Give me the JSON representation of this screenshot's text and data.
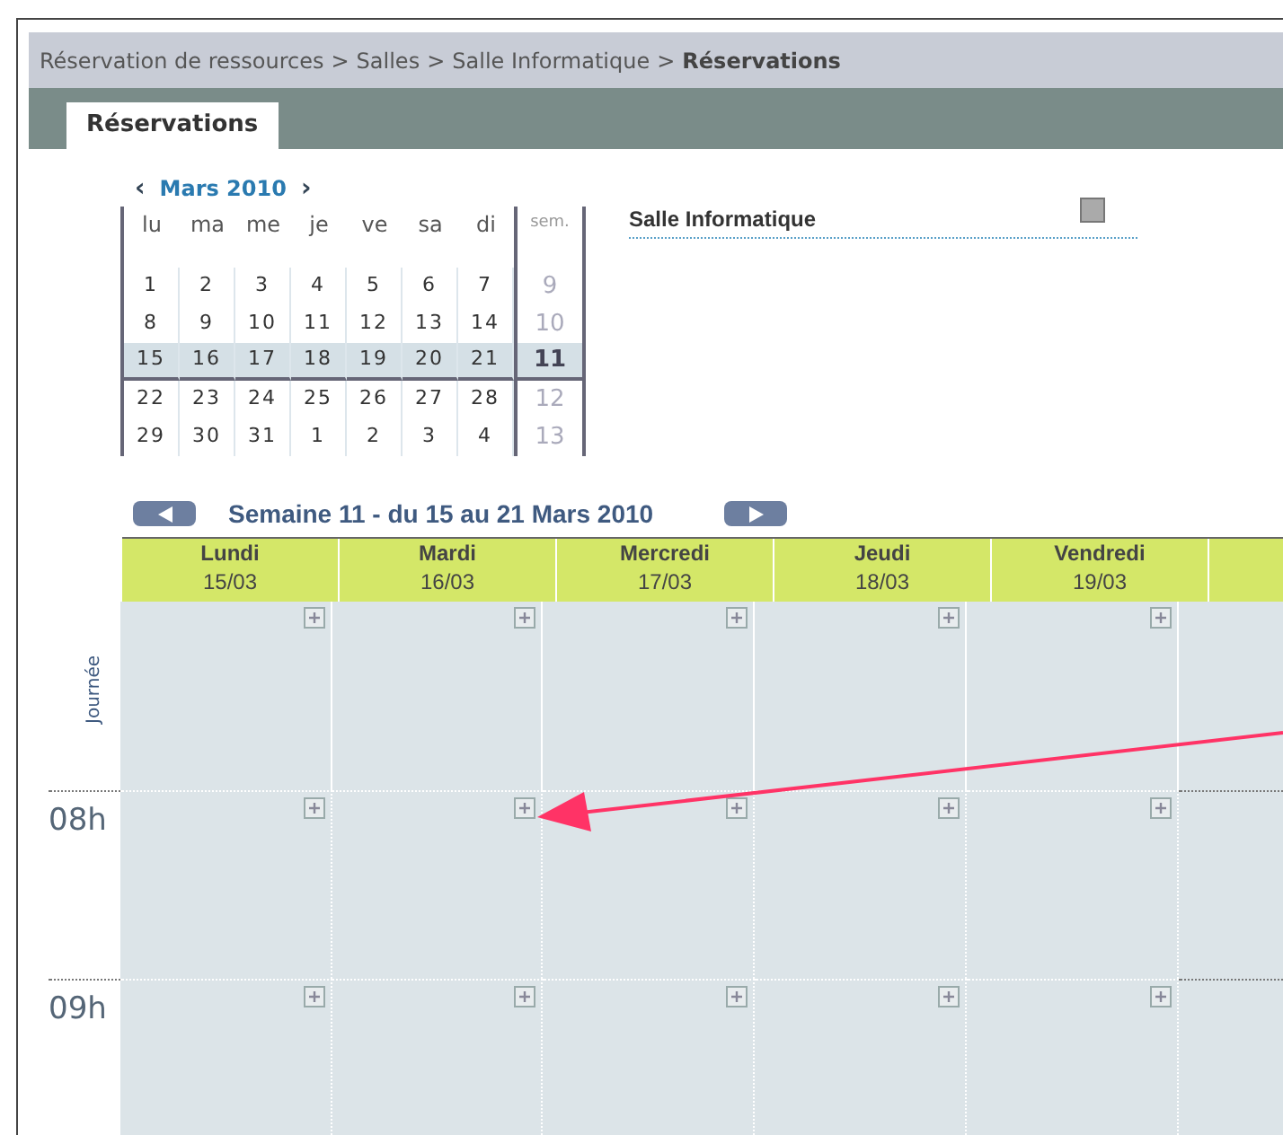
{
  "breadcrumb": {
    "items": [
      "Réservation de ressources",
      "Salles",
      "Salle Informatique"
    ],
    "current": "Réservations",
    "separator": ">"
  },
  "tabs": [
    {
      "label": "Réservations",
      "selected": true
    }
  ],
  "mini_calendar": {
    "title": "Mars 2010",
    "prev": "‹",
    "next": "›",
    "weekdays": [
      "lu",
      "ma",
      "me",
      "je",
      "ve",
      "sa",
      "di"
    ],
    "week_header": "sem.",
    "weeks": [
      {
        "days": [
          "1",
          "2",
          "3",
          "4",
          "5",
          "6",
          "7"
        ],
        "week": "9",
        "selected": false
      },
      {
        "days": [
          "8",
          "9",
          "10",
          "11",
          "12",
          "13",
          "14"
        ],
        "week": "10",
        "selected": false
      },
      {
        "days": [
          "15",
          "16",
          "17",
          "18",
          "19",
          "20",
          "21"
        ],
        "week": "11",
        "selected": true
      },
      {
        "days": [
          "22",
          "23",
          "24",
          "25",
          "26",
          "27",
          "28"
        ],
        "week": "12",
        "selected": false
      },
      {
        "days": [
          "29",
          "30",
          "31",
          "1",
          "2",
          "3",
          "4"
        ],
        "week": "13",
        "selected": false
      }
    ]
  },
  "resource": {
    "label": "Salle Informatique",
    "checked": false
  },
  "week_view": {
    "title": "Semaine 11 - du 15 au 21 Mars 2010",
    "days": [
      {
        "name": "Lundi",
        "date": "15/03"
      },
      {
        "name": "Mardi",
        "date": "16/03"
      },
      {
        "name": "Mercredi",
        "date": "17/03"
      },
      {
        "name": "Jeudi",
        "date": "18/03"
      },
      {
        "name": "Vendredi",
        "date": "19/03"
      }
    ],
    "rows": [
      {
        "label": "Journée",
        "kind": "allday"
      },
      {
        "label": "08h",
        "kind": "hour"
      },
      {
        "label": "09h",
        "kind": "hour"
      }
    ]
  }
}
